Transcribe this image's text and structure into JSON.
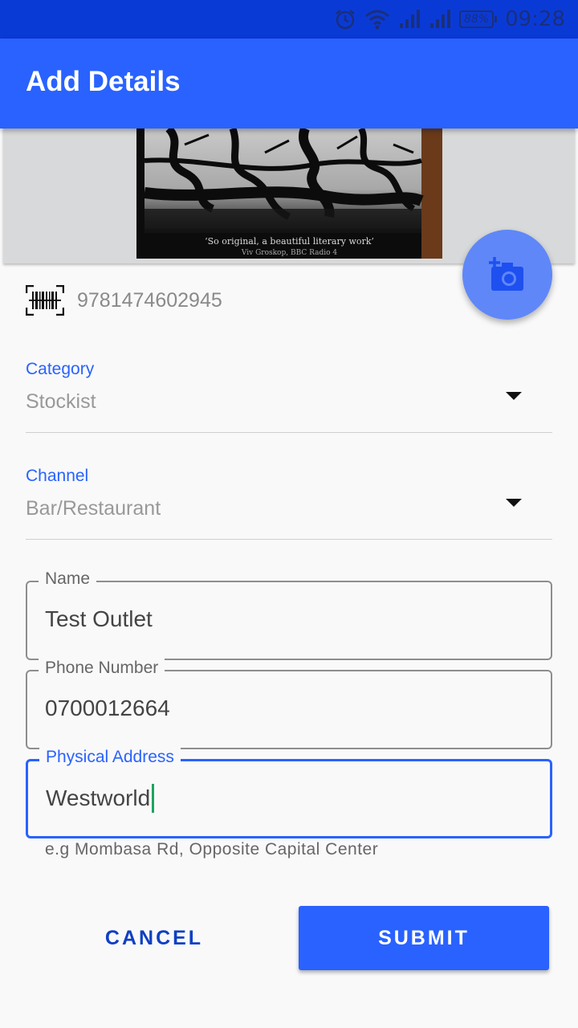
{
  "status_bar": {
    "battery": "88%",
    "time": "09:28"
  },
  "app_bar": {
    "title": "Add Details"
  },
  "photo": {
    "caption": "‘So original, a beautiful literary work’",
    "sub_caption": "Viv Groskop, BBC Radio 4"
  },
  "barcode": {
    "value": "9781474602945"
  },
  "category": {
    "label": "Category",
    "value": "Stockist"
  },
  "channel": {
    "label": "Channel",
    "value": "Bar/Restaurant"
  },
  "name_field": {
    "label": "Name",
    "value": "Test Outlet"
  },
  "phone_field": {
    "label": "Phone Number",
    "value": "0700012664"
  },
  "address_field": {
    "label": "Physical Address",
    "value": "Westworld",
    "helper": "e.g Mombasa Rd, Opposite Capital Center"
  },
  "actions": {
    "cancel": "CANCEL",
    "submit": "SUBMIT"
  },
  "colors": {
    "primary": "#2962ff",
    "status_bar": "#0a3ad6",
    "fab": "#5f87f8",
    "cursor": "#1ea362"
  },
  "icons": [
    "alarm-icon",
    "wifi-icon",
    "signal-icon",
    "battery-icon",
    "add-photo-icon",
    "barcode-icon",
    "dropdown-arrow-icon"
  ]
}
